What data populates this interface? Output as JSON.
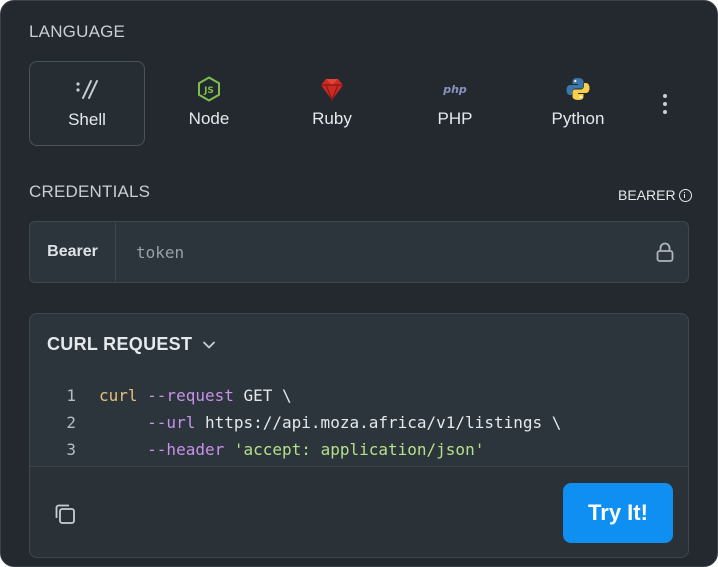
{
  "language": {
    "label": "LANGUAGE",
    "items": [
      {
        "name": "Shell",
        "icon": "shell-icon",
        "active": true
      },
      {
        "name": "Node",
        "icon": "nodejs-icon",
        "active": false
      },
      {
        "name": "Ruby",
        "icon": "ruby-icon",
        "active": false
      },
      {
        "name": "PHP",
        "icon": "php-icon",
        "active": false
      },
      {
        "name": "Python",
        "icon": "python-icon",
        "active": false
      }
    ],
    "more_icon": "more-vertical-icon"
  },
  "credentials": {
    "label": "CREDENTIALS",
    "auth_type": "BEARER",
    "prefix": "Bearer",
    "token_placeholder": "token",
    "token_value": ""
  },
  "request": {
    "title": "CURL REQUEST",
    "lines": [
      {
        "num": "1",
        "parts": [
          {
            "t": "curl",
            "c": "cmd"
          },
          {
            "t": " --request",
            "c": "flag"
          },
          {
            "t": " GET \\",
            "c": "plain"
          }
        ]
      },
      {
        "num": "2",
        "parts": [
          {
            "t": "     --url",
            "c": "flag"
          },
          {
            "t": " https://api.moza.africa/v1/listings \\",
            "c": "plain"
          }
        ]
      },
      {
        "num": "3",
        "parts": [
          {
            "t": "     --header",
            "c": "flag"
          },
          {
            "t": " ",
            "c": "plain"
          },
          {
            "t": "'accept: application/json'",
            "c": "str"
          }
        ]
      }
    ],
    "try_label": "Try It!"
  },
  "colors": {
    "panel_bg": "#23292f",
    "accent": "#0f8ff2",
    "node_green": "#7cc04b",
    "ruby_red": "#cc2a22",
    "php_purple": "#8892bf",
    "python_blue": "#3b77a8",
    "python_yellow": "#f7d14c"
  }
}
